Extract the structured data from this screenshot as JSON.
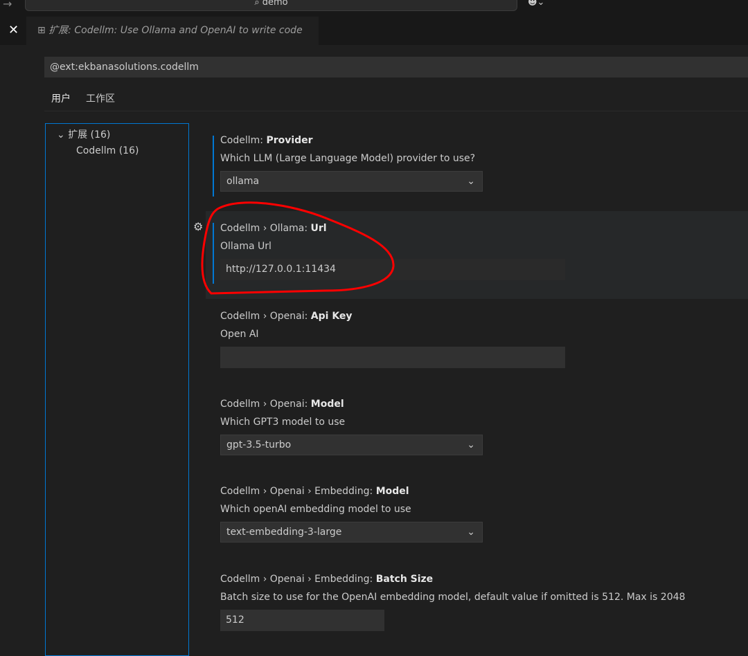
{
  "topbar": {
    "search_text": "demo"
  },
  "tab": {
    "title": "扩展: Codellm: Use Ollama and OpenAI to write code"
  },
  "search": {
    "value": "@ext:ekbanasolutions.codellm"
  },
  "scopes": [
    "用户",
    "工作区"
  ],
  "tree": {
    "group": "扩展 (16)",
    "child": "Codellm (16)"
  },
  "settings": [
    {
      "prefix": "Codellm: ",
      "name": "Provider",
      "desc": "Which LLM (Large Language Model) provider to use?",
      "value": "ollama",
      "type": "select"
    },
    {
      "prefix": "Codellm › Ollama: ",
      "name": "Url",
      "desc": "Ollama Url",
      "value": "http://127.0.0.1:11434",
      "type": "text"
    },
    {
      "prefix": "Codellm › Openai: ",
      "name": "Api Key",
      "desc": "Open AI",
      "value": "",
      "type": "text"
    },
    {
      "prefix": "Codellm › Openai: ",
      "name": "Model",
      "desc": "Which GPT3 model to use",
      "value": "gpt-3.5-turbo",
      "type": "select"
    },
    {
      "prefix": "Codellm › Openai › Embedding: ",
      "name": "Model",
      "desc": "Which openAI embedding model to use",
      "value": "text-embedding-3-large",
      "type": "select"
    },
    {
      "prefix": "Codellm › Openai › Embedding: ",
      "name": "Batch Size",
      "desc": "Batch size to use for the OpenAI embedding model, default value if omitted is 512. Max is 2048",
      "value": "512",
      "type": "number"
    }
  ],
  "colors": {
    "accent": "#0078d4",
    "annotation": "#ff0000"
  }
}
